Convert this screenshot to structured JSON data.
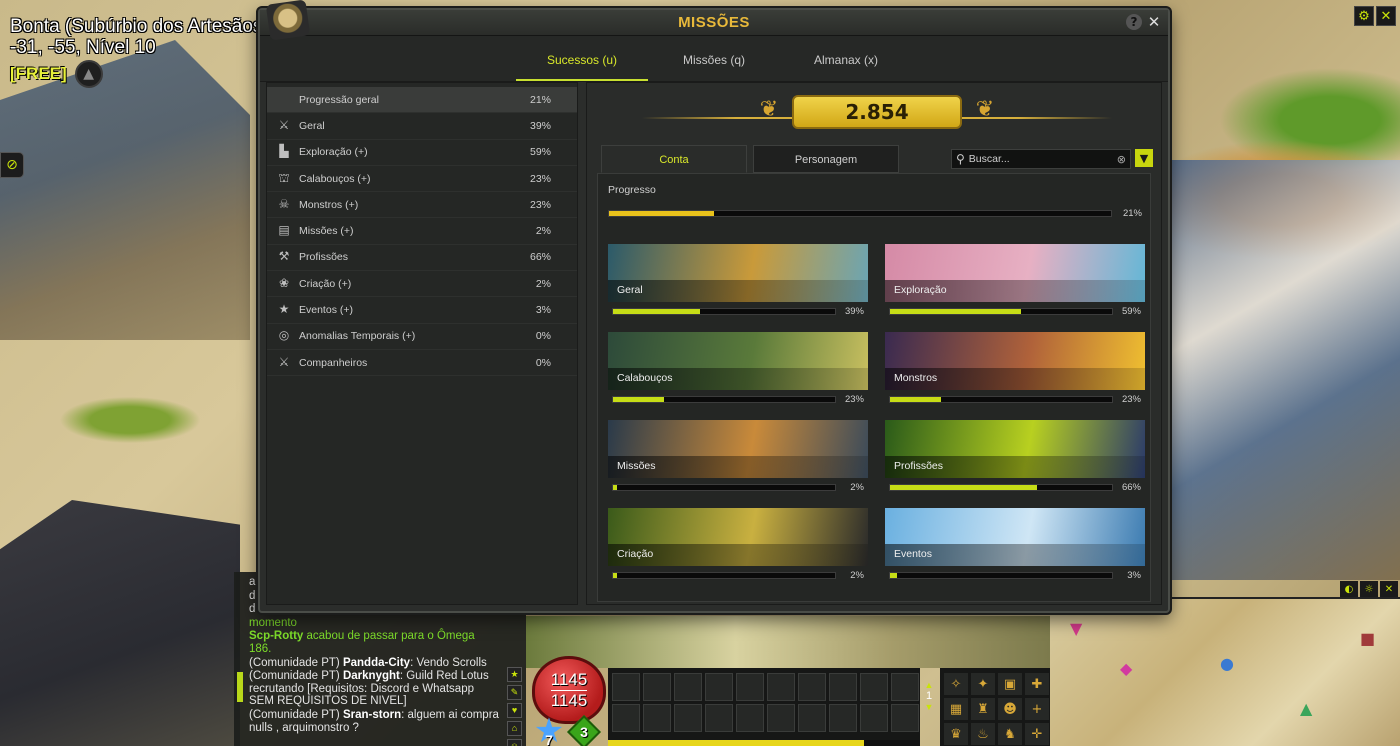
{
  "location": {
    "name": "Bonta (Subúrbio dos Artesãos)",
    "coords": "-31, -55, Nível 10",
    "free_tag": "[FREE]"
  },
  "window": {
    "title": "MISSÕES",
    "tabs": [
      {
        "label": "Sucessos (u)",
        "active": true
      },
      {
        "label": "Missões (q)",
        "active": false
      },
      {
        "label": "Almanax (x)",
        "active": false
      }
    ]
  },
  "categories": [
    {
      "label": "Progressão geral",
      "pct": "21%",
      "icon": "none"
    },
    {
      "label": "Geral",
      "pct": "39%",
      "icon": "sword-icon"
    },
    {
      "label": "Exploração (+)",
      "pct": "59%",
      "icon": "boot-icon"
    },
    {
      "label": "Calabouços (+)",
      "pct": "23%",
      "icon": "dungeon-icon"
    },
    {
      "label": "Monstros (+)",
      "pct": "23%",
      "icon": "monster-icon"
    },
    {
      "label": "Missões (+)",
      "pct": "2%",
      "icon": "scroll-icon"
    },
    {
      "label": "Profissões",
      "pct": "66%",
      "icon": "hammer-icon"
    },
    {
      "label": "Criação (+)",
      "pct": "2%",
      "icon": "paw-icon"
    },
    {
      "label": "Eventos (+)",
      "pct": "3%",
      "icon": "star-icon"
    },
    {
      "label": "Anomalias Temporais (+)",
      "pct": "0%",
      "icon": "spiral-icon"
    },
    {
      "label": "Companheiros",
      "pct": "0%",
      "icon": "companion-icon"
    }
  ],
  "score": "2.854",
  "subtabs": [
    "Conta",
    "Personagem"
  ],
  "search": {
    "placeholder": "Buscar..."
  },
  "progress": {
    "label": "Progresso",
    "pct_label": "21%",
    "value": 0.21
  },
  "cards": [
    {
      "label": "Geral",
      "pct_label": "39%",
      "value": 0.39,
      "colors": [
        "#2b5a6a",
        "#c99a3a",
        "#6aa5b5"
      ]
    },
    {
      "label": "Exploração",
      "pct_label": "59%",
      "value": 0.59,
      "colors": [
        "#d58aa6",
        "#e7b0c3",
        "#62b7d6"
      ]
    },
    {
      "label": "Calabouços",
      "pct_label": "23%",
      "value": 0.23,
      "colors": [
        "#2d4a3a",
        "#5a7a3a",
        "#c9c060"
      ]
    },
    {
      "label": "Monstros",
      "pct_label": "23%",
      "value": 0.23,
      "colors": [
        "#3a2a50",
        "#b0623a",
        "#f0c030"
      ]
    },
    {
      "label": "Missões",
      "pct_label": "2%",
      "value": 0.02,
      "colors": [
        "#2a3a4a",
        "#c98a3a",
        "#3a4a5a"
      ]
    },
    {
      "label": "Profissões",
      "pct_label": "66%",
      "value": 0.66,
      "colors": [
        "#2a5a1a",
        "#b8d020",
        "#2a3a6a"
      ]
    },
    {
      "label": "Criação",
      "pct_label": "2%",
      "value": 0.02,
      "colors": [
        "#3a5a1a",
        "#c9b040",
        "#2a2a2a"
      ]
    },
    {
      "label": "Eventos",
      "pct_label": "3%",
      "value": 0.03,
      "colors": [
        "#6ab0e0",
        "#cfe6f5",
        "#3a7ab0"
      ]
    }
  ],
  "chat": {
    "lines_top": [
      "a",
      "d",
      "d"
    ],
    "momento": "momento",
    "system_name": "Scp-Rotty",
    "system_text": "acabou de passar para o Ômega 186.",
    "msgs": [
      {
        "prefix": "(Comunidade PT)",
        "name": "Pandda-City",
        "text": ": Vendo Scrolls"
      },
      {
        "prefix": "(Comunidade PT)",
        "name": "Darknyght",
        "text": ": Guild Red Lotus recrutando [Requisitos: Discord e Whatsapp SEM REQUISITOS DE NIVEL]"
      },
      {
        "prefix": "(Comunidade PT)",
        "name": "Sran-storn",
        "text": ": alguem ai compra nulls , arquimonstro ?"
      }
    ]
  },
  "hud": {
    "hp_current": "1145",
    "hp_max": "1145",
    "ap": "7",
    "mp": "3",
    "bar_page": "1",
    "xp_value": 0.82
  }
}
